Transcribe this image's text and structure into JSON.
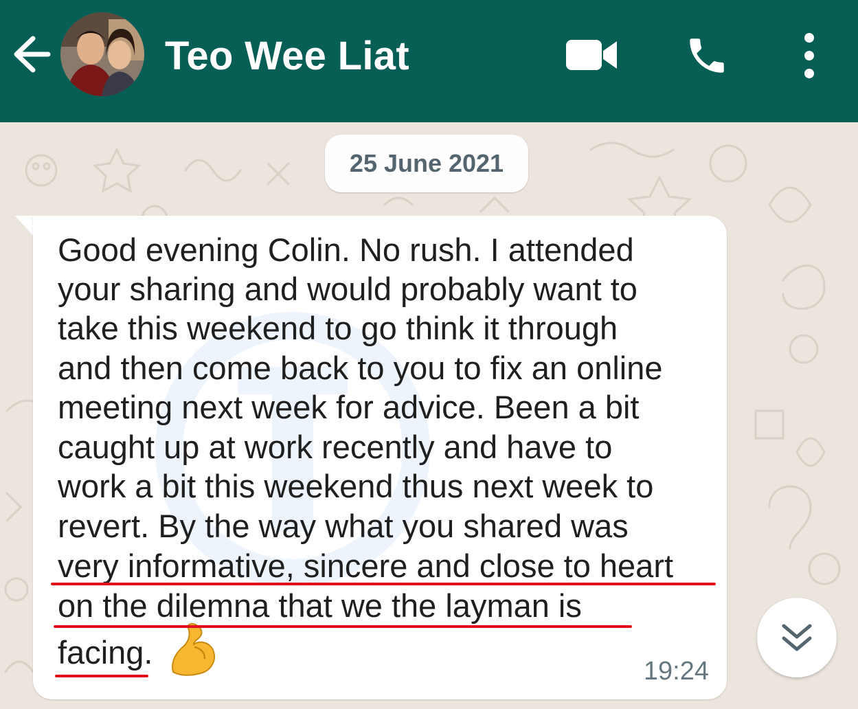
{
  "header": {
    "contact_name": "Teo Wee Liat",
    "background_color": "#075e54",
    "icons": [
      "back-arrow-icon",
      "video-call-icon",
      "voice-call-icon",
      "more-options-icon"
    ]
  },
  "chat": {
    "date_chip": "25 June 2021",
    "message": {
      "lines": [
        "Good evening Colin. No rush. I attended",
        "your sharing and would probably want to",
        "take this weekend to go think it through",
        "and then come back to you to fix an online",
        "meeting next week for advice. Been a bit",
        "caught up at work recently and have to",
        "work a bit this weekend thus next week to",
        "revert. By the way what you shared was",
        "very informative, sincere and close to heart",
        "on the dilemna that we the layman is",
        "facing."
      ],
      "emoji": "flexed-biceps-emoji",
      "time": "19:24"
    },
    "annotation_color": "#e1101c",
    "scroll_button_icon": "double-chevron-down-icon"
  }
}
